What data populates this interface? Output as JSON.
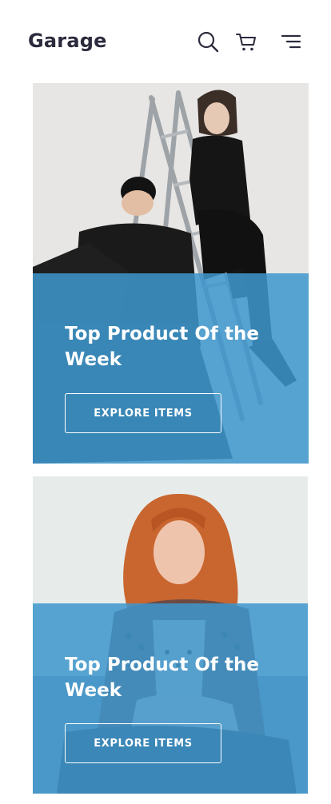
{
  "header": {
    "brand": "Garage",
    "icons": [
      "search-icon",
      "cart-icon",
      "menu-icon"
    ]
  },
  "cards": [
    {
      "title": "Top Product Of the Week",
      "button_label": "EXPLORE ITEMS"
    },
    {
      "title": "Top Product Of the Week",
      "button_label": "EXPLORE ITEMS"
    }
  ],
  "colors": {
    "brand_text": "#2b2b3d",
    "overlay": "#3e96cd",
    "button_text": "#ffffff"
  }
}
